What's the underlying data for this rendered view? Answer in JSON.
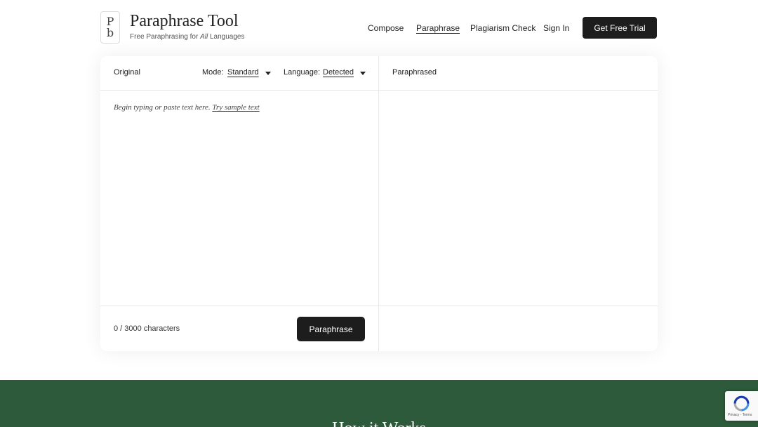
{
  "brand": {
    "logo_top": "P",
    "logo_bottom": "b",
    "title": "Paraphrase Tool",
    "subtitle_prefix": "Free Paraphrasing for ",
    "subtitle_emphasis": "All",
    "subtitle_suffix": " Languages"
  },
  "nav": {
    "items": [
      "Compose",
      "Paraphrase",
      "Plagiarism Check",
      "Sign In"
    ],
    "active": "Paraphrase",
    "cta_label": "Get Free Trial"
  },
  "tool": {
    "original_label": "Original",
    "paraphrased_label": "Paraphrased",
    "mode_label": "Mode:",
    "mode_value": "Standard",
    "language_label": "Language:",
    "language_value": "Detected",
    "placeholder_text": "Begin typing or paste text here.",
    "sample_link": "Try sample text",
    "char_count": "0 / 3000 characters",
    "paraphrase_button": "Paraphrase"
  },
  "section": {
    "heading": "How it Works"
  },
  "recaptcha": {
    "links": "Privacy - Terms"
  },
  "colors": {
    "primary_button": "#1d1d1d",
    "band_green": "#2d5a3b"
  }
}
